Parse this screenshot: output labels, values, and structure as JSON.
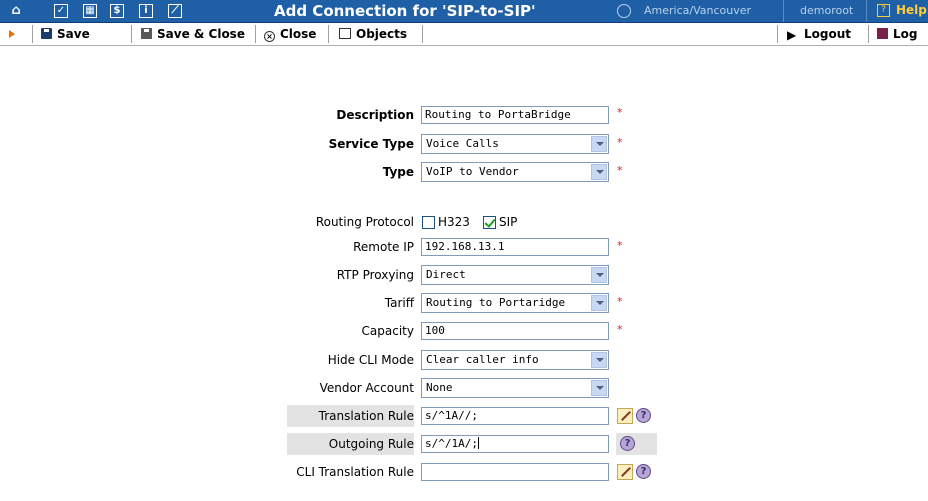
{
  "titlebar": {
    "title": "Add Connection for 'SIP-to-SIP'",
    "timezone": "America/Vancouver",
    "user": "demoroot",
    "help": "Help",
    "icons": [
      "home-icon",
      "checklist-icon",
      "grid-icon",
      "dollar-icon",
      "info-icon",
      "chart-icon"
    ]
  },
  "toolbar": {
    "save": "Save",
    "save_close": "Save & Close",
    "close": "Close",
    "objects": "Objects",
    "logout": "Logout",
    "log": "Log"
  },
  "form": {
    "description": {
      "label": "Description",
      "value": "Routing to PortaBridge",
      "required": "*"
    },
    "service_type": {
      "label": "Service Type",
      "value": "Voice Calls",
      "required": "*"
    },
    "type": {
      "label": "Type",
      "value": "VoIP to Vendor",
      "required": "*"
    },
    "routing_protocol": {
      "label": "Routing Protocol",
      "h323": "H323",
      "sip": "SIP",
      "h323_checked": false,
      "sip_checked": true
    },
    "remote_ip": {
      "label": "Remote IP",
      "value": "192.168.13.1",
      "required": "*"
    },
    "rtp_proxying": {
      "label": "RTP Proxying",
      "value": "Direct"
    },
    "tariff": {
      "label": "Tariff",
      "value": "Routing to Portaridge",
      "required": "*"
    },
    "capacity": {
      "label": "Capacity",
      "value": "100",
      "required": "*"
    },
    "hide_cli_mode": {
      "label": "Hide CLI Mode",
      "value": "Clear caller info"
    },
    "vendor_account": {
      "label": "Vendor Account",
      "value": "None"
    },
    "translation_rule": {
      "label": "Translation Rule",
      "value": "s/^1A//;"
    },
    "outgoing_rule": {
      "label": "Outgoing Rule",
      "value": "s/^/1A/;"
    },
    "cli_translation_rule": {
      "label": "CLI Translation Rule",
      "value": ""
    },
    "help_glyph": "?"
  },
  "colors": {
    "titlebar": "#1f5fa5",
    "required": "#e32020",
    "accent": "#e8700a"
  }
}
